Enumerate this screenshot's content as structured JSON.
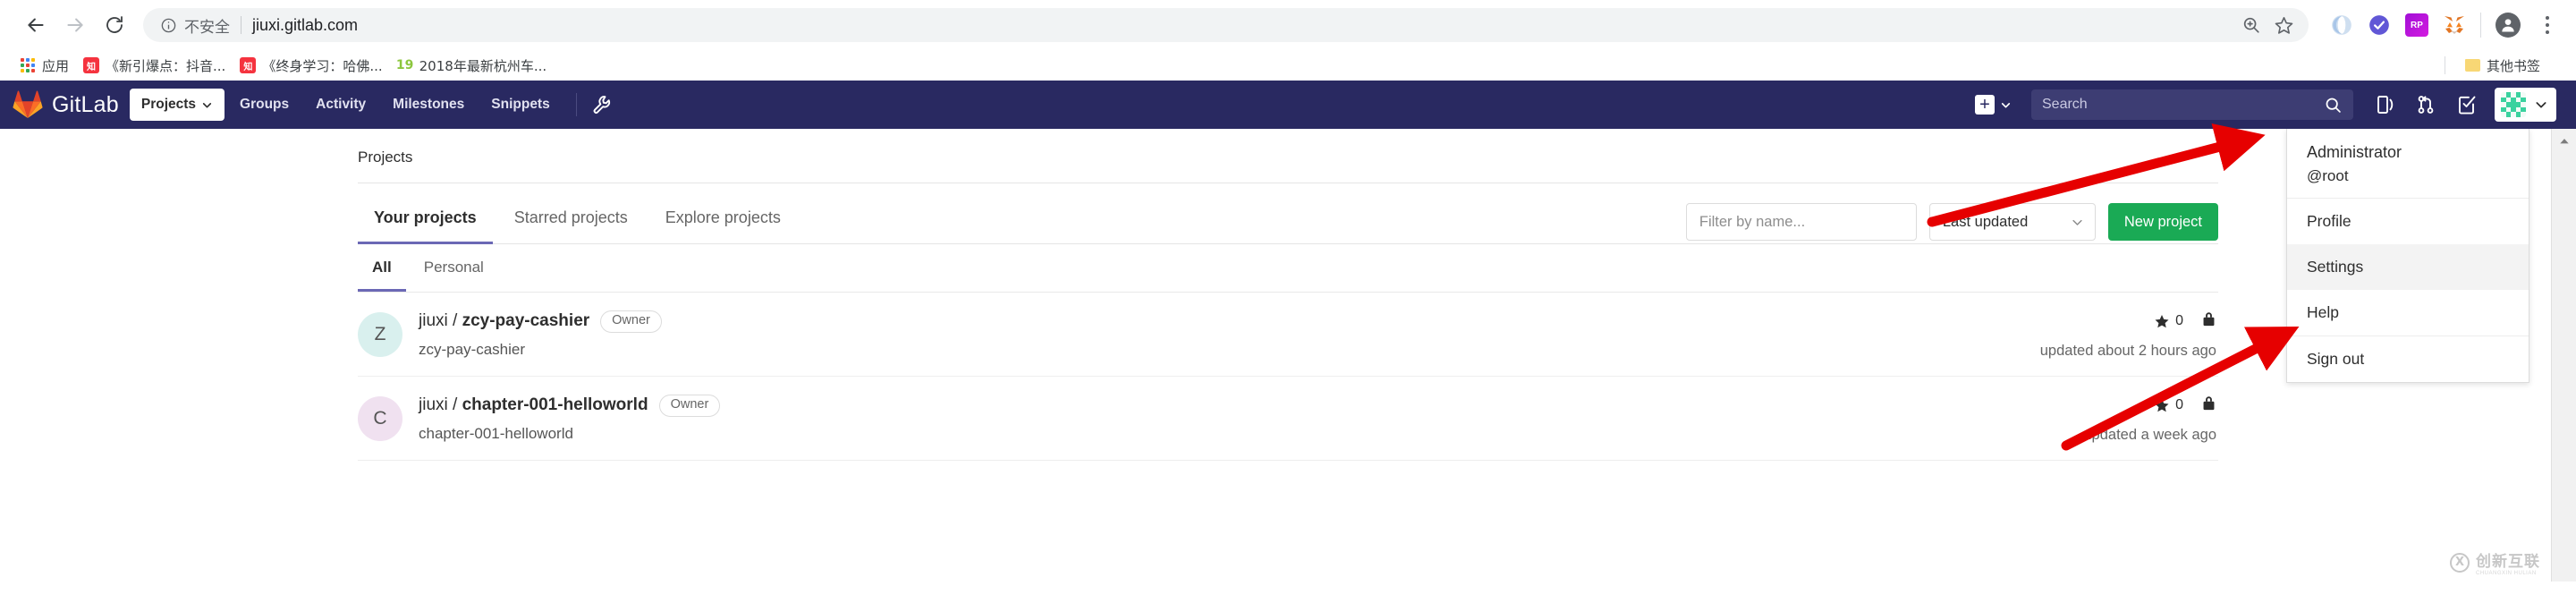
{
  "browser": {
    "back_label": "back-arrow",
    "forward_label": "forward-arrow",
    "reload_label": "reload",
    "security_text": "不安全",
    "url": "jiuxi.gitlab.com",
    "zoom_icon": "zoom-icon",
    "bookmark_star_icon": "star-icon",
    "extensions": [
      {
        "name": "opera-extension",
        "short": ""
      },
      {
        "name": "check-badge-extension",
        "short": ""
      },
      {
        "name": "rp-extension",
        "short": "RP"
      },
      {
        "name": "metamask-extension",
        "short": ""
      }
    ],
    "bookmarks": [
      {
        "label": "应用",
        "icon": "apps-grid-icon"
      },
      {
        "label": "《新引爆点：抖音...",
        "icon": "zhihu-icon"
      },
      {
        "label": "《终身学习：哈佛...",
        "icon": "zhihu-icon"
      },
      {
        "label": "2018年最新杭州车...",
        "icon": "nineteen-icon"
      }
    ],
    "other_bookmarks": "其他书签"
  },
  "navbar": {
    "brand": "GitLab",
    "items": [
      {
        "label": "Projects",
        "active": true,
        "caret": true
      },
      {
        "label": "Groups",
        "active": false,
        "caret": false
      },
      {
        "label": "Activity",
        "active": false,
        "caret": false
      },
      {
        "label": "Milestones",
        "active": false,
        "caret": false
      },
      {
        "label": "Snippets",
        "active": false,
        "caret": false
      }
    ],
    "admin_icon": "wrench-icon",
    "new_icon": "plus-icon",
    "search_placeholder": "Search",
    "search_value": "",
    "icons": [
      {
        "name": "issue-boards-icon"
      },
      {
        "name": "merge-requests-icon"
      },
      {
        "name": "todos-icon"
      }
    ],
    "avatar_icon": "user-identicon",
    "avatar_caret": "chevron-down-icon",
    "bg_color": "#292961"
  },
  "user_dropdown": {
    "name": "Administrator",
    "username": "@root",
    "items": [
      {
        "label": "Profile",
        "highlighted": false
      },
      {
        "label": "Settings",
        "highlighted": true
      },
      {
        "label": "Help",
        "highlighted": false
      },
      {
        "label": "Sign out",
        "highlighted": false
      }
    ]
  },
  "main": {
    "breadcrumb": "Projects",
    "tabs": [
      {
        "label": "Your projects",
        "active": true
      },
      {
        "label": "Starred projects",
        "active": false
      },
      {
        "label": "Explore projects",
        "active": false
      }
    ],
    "subtabs": [
      {
        "label": "All",
        "active": true
      },
      {
        "label": "Personal",
        "active": false
      }
    ],
    "filter_placeholder": "Filter by name...",
    "filter_value": "",
    "sort_value": "Last updated",
    "new_project_label": "New project",
    "new_project_color": "#1aaa55",
    "projects": [
      {
        "avatar_letter": "Z",
        "avatar_color": "#d9f0ee",
        "namespace": "jiuxi / ",
        "name": "zcy-pay-cashier",
        "role_badge": "Owner",
        "description": "zcy-pay-cashier",
        "stars": "0",
        "visibility_icon": "lock-icon",
        "updated": "updated about 2 hours ago"
      },
      {
        "avatar_letter": "C",
        "avatar_color": "#f0e1f0",
        "namespace": "jiuxi / ",
        "name": "chapter-001-helloworld",
        "role_badge": "Owner",
        "description": "chapter-001-helloworld",
        "stars": "0",
        "visibility_icon": "lock-icon",
        "updated": "updated a week ago"
      }
    ]
  },
  "annotations": {
    "arrow_color": "#e60000",
    "arrow1_target": "avatar-button",
    "arrow2_target": "settings-menu-item"
  },
  "watermark": {
    "text": "创新互联",
    "sub": "CHUANGXIN HULIAN"
  }
}
